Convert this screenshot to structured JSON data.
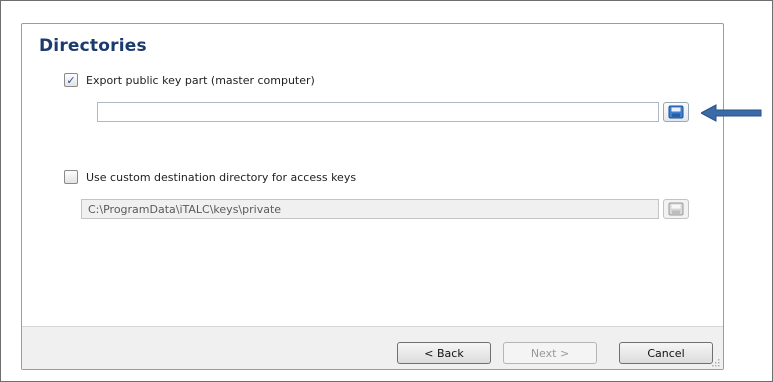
{
  "dialog": {
    "title": "Directories"
  },
  "export_public_key": {
    "label": "Export public key part (master computer)",
    "checked": true,
    "path_value": "",
    "browse_icon": "save-icon"
  },
  "custom_destination": {
    "label": "Use custom destination directory for access keys",
    "checked": false,
    "path_value": "C:\\ProgramData\\iTALC\\keys\\private",
    "browse_icon": "save-icon"
  },
  "footer": {
    "back_label": "< Back",
    "next_label": "Next >",
    "cancel_label": "Cancel"
  },
  "annotation": {
    "icon": "arrow-left-icon",
    "color": "#3a6aa8"
  }
}
